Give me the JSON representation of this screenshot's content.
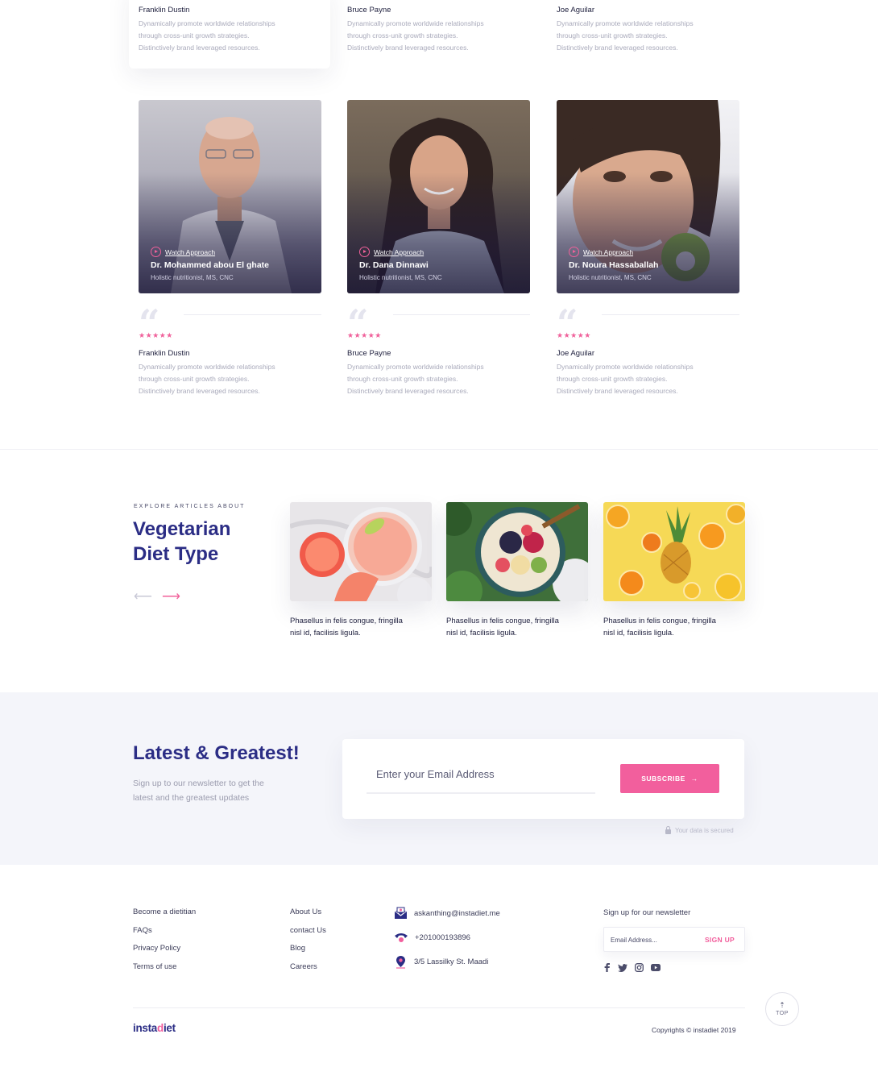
{
  "top_reviews": [
    {
      "name": "Franklin Dustin",
      "lines": [
        "Dynamically promote worldwide relationships",
        "through cross-unit growth strategies.",
        "Distinctively brand leveraged resources."
      ]
    },
    {
      "name": "Bruce Payne",
      "lines": [
        "Dynamically promote worldwide relationships",
        "through cross-unit growth strategies.",
        "Distinctively brand leveraged resources."
      ]
    },
    {
      "name": "Joe Aguilar",
      "lines": [
        "Dynamically promote worldwide relationships",
        "through cross-unit growth strategies.",
        "Distinctively brand leveraged resources."
      ]
    }
  ],
  "doctors": [
    {
      "watch_label": "Watch Approach",
      "name": "Dr. Mohammed abou El ghate",
      "role": "Holistic nutritionist, MS, CNC"
    },
    {
      "watch_label": "Watch Approach",
      "name": "Dr. Dana Dinnawi",
      "role": "Holistic nutritionist, MS, CNC"
    },
    {
      "watch_label": "Watch Approach",
      "name": "Dr. Noura Hassaballah",
      "role": "Holistic nutritionist, MS, CNC"
    }
  ],
  "reviews": [
    {
      "stars": "★★★★★",
      "rating": 5,
      "name": "Franklin Dustin",
      "lines": [
        "Dynamically promote worldwide relationships",
        "through cross-unit growth strategies.",
        "Distinctively brand leveraged resources."
      ]
    },
    {
      "stars": "★★★★★",
      "rating": 5,
      "name": "Bruce Payne",
      "lines": [
        "Dynamically promote worldwide relationships",
        "through cross-unit growth strategies.",
        "Distinctively brand leveraged resources."
      ]
    },
    {
      "stars": "★★★★★",
      "rating": 5,
      "name": "Joe Aguilar",
      "lines": [
        "Dynamically promote worldwide relationships",
        "through cross-unit growth strategies.",
        "Distinctively brand leveraged resources."
      ]
    }
  ],
  "articles": {
    "eyebrow": "EXPLORE ARTICLES ABOUT",
    "title_line1": "Vegetarian",
    "title_line2": "Diet Type",
    "prev_icon": "arrow-left-icon",
    "next_icon": "arrow-right-icon",
    "items": [
      {
        "caption_line1": "Phasellus in felis congue, fringilla",
        "caption_line2": "nisl id, facilisis ligula."
      },
      {
        "caption_line1": "Phasellus in felis congue, fringilla",
        "caption_line2": "nisl id, facilisis ligula."
      },
      {
        "caption_line1": "Phasellus in felis congue, fringilla",
        "caption_line2": "nisl id, facilisis ligula."
      }
    ]
  },
  "newsletter": {
    "title": "Latest & Greatest!",
    "subtitle_line1": "Sign up to our newsletter to get the",
    "subtitle_line2": "latest and the greatest updates",
    "email_placeholder": "Enter your Email Address",
    "subscribe_label": "SUBSCRIBE",
    "secured_text": "Your data is secured"
  },
  "footer": {
    "col1": [
      "Become a dietitian",
      "FAQs",
      "Privacy Policy",
      "Terms of use"
    ],
    "col2": [
      "About Us",
      "contact Us",
      "Blog",
      "Careers"
    ],
    "email": "askanthing@instadiet.me",
    "phone": "+201000193896",
    "address": "3/5 Lassilky St. Maadi",
    "newsletter_title": "Sign up for our newsletter",
    "newsletter_placeholder": "Email Address...",
    "signup_label": "SIGN UP",
    "social_icons": [
      "facebook-icon",
      "twitter-icon",
      "instagram-icon",
      "youtube-icon"
    ],
    "top_label": "TOP",
    "logo_left": "insta",
    "logo_mid": "d",
    "logo_right": "iet",
    "copyright": "Copyrights © instadiet 2019"
  },
  "colors": {
    "brand": "#2b2d85",
    "accent": "#f25f9d",
    "muted_text": "#a9aabb",
    "section_bg": "#f4f5fa"
  }
}
